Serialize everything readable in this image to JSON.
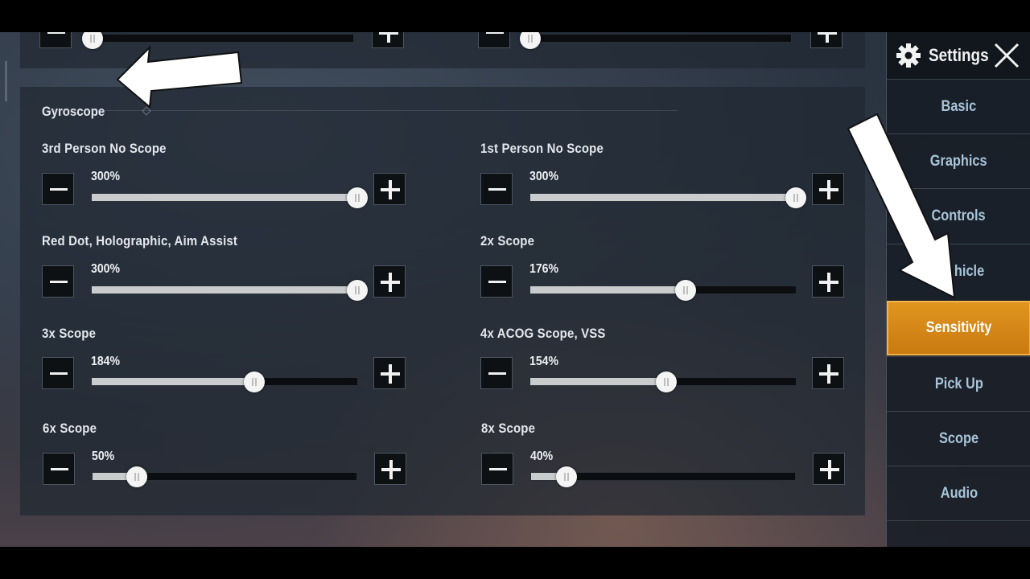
{
  "header": {
    "title": "Settings",
    "icon": "gear-icon",
    "close_icon": "close-icon"
  },
  "sidebar": {
    "tabs": [
      {
        "label": "Basic",
        "active": false
      },
      {
        "label": "Graphics",
        "active": false
      },
      {
        "label": "Controls",
        "active": false
      },
      {
        "label": "Vehicle",
        "visible_label": "hicle",
        "active": false
      },
      {
        "label": "Sensitivity",
        "active": true
      },
      {
        "label": "Pick Up",
        "active": false
      },
      {
        "label": "Scope",
        "active": false
      },
      {
        "label": "Audio",
        "active": false
      }
    ],
    "accent_color": "#d98a18"
  },
  "gyroscope": {
    "section_title": "Gyroscope",
    "settings": [
      {
        "label": "3rd Person No Scope",
        "value": "300%",
        "fraction": 1.0
      },
      {
        "label": "1st Person No Scope",
        "value": "300%",
        "fraction": 1.0
      },
      {
        "label": "Red Dot, Holographic, Aim Assist",
        "value": "300%",
        "fraction": 1.0
      },
      {
        "label": "2x Scope",
        "value": "176%",
        "fraction": 0.586
      },
      {
        "label": "3x Scope",
        "value": "184%",
        "fraction": 0.613
      },
      {
        "label": "4x ACOG Scope, VSS",
        "value": "154%",
        "fraction": 0.513
      },
      {
        "label": "6x Scope",
        "value": "50%",
        "fraction": 0.167
      },
      {
        "label": "8x Scope",
        "value": "40%",
        "fraction": 0.133
      }
    ]
  },
  "previous_section": {
    "sliders": [
      {
        "fraction": 0.0
      },
      {
        "fraction": 0.0
      }
    ]
  },
  "annotations": {
    "arrow_color": "#ffffff",
    "arrows": [
      "pointing to Gyroscope section",
      "pointing to Sensitivity tab"
    ]
  }
}
